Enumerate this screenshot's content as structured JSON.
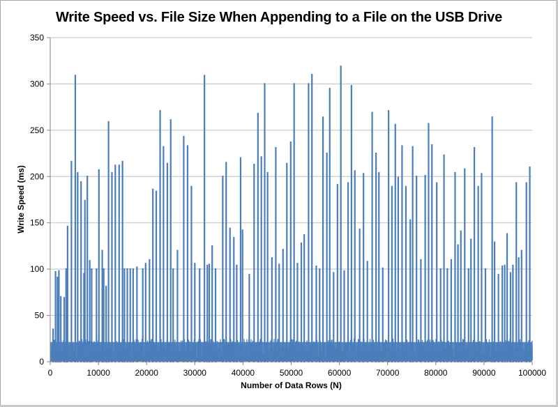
{
  "chart_data": {
    "type": "line",
    "title": "Write Speed vs. File Size When Appending to a File on the USB Drive",
    "xlabel": "Number of Data Rows (N)",
    "ylabel": "Write Speed (ms)",
    "xlim": [
      0,
      100000
    ],
    "ylim": [
      0,
      350
    ],
    "xticks": [
      0,
      10000,
      20000,
      30000,
      40000,
      50000,
      60000,
      70000,
      80000,
      90000,
      100000
    ],
    "yticks": [
      0,
      50,
      100,
      150,
      200,
      250,
      300,
      350
    ],
    "grid": "horizontal",
    "legend": "none",
    "series_color": "#4a7ebb",
    "series": [
      {
        "name": "Write Speed",
        "baseline_range_ms": [
          0,
          25
        ],
        "spikes": [
          {
            "x": 600,
            "y": 35
          },
          {
            "x": 1100,
            "y": 97
          },
          {
            "x": 1500,
            "y": 91
          },
          {
            "x": 1800,
            "y": 98
          },
          {
            "x": 2200,
            "y": 70
          },
          {
            "x": 2900,
            "y": 69
          },
          {
            "x": 3300,
            "y": 100
          },
          {
            "x": 3600,
            "y": 146
          },
          {
            "x": 4400,
            "y": 216
          },
          {
            "x": 5200,
            "y": 309
          },
          {
            "x": 5700,
            "y": 204
          },
          {
            "x": 6400,
            "y": 194
          },
          {
            "x": 7000,
            "y": 95
          },
          {
            "x": 7200,
            "y": 174
          },
          {
            "x": 7700,
            "y": 200
          },
          {
            "x": 8200,
            "y": 109
          },
          {
            "x": 8600,
            "y": 100
          },
          {
            "x": 9600,
            "y": 100
          },
          {
            "x": 10100,
            "y": 207
          },
          {
            "x": 10800,
            "y": 120
          },
          {
            "x": 11100,
            "y": 100
          },
          {
            "x": 11600,
            "y": 81
          },
          {
            "x": 12100,
            "y": 259
          },
          {
            "x": 12800,
            "y": 204
          },
          {
            "x": 13500,
            "y": 212
          },
          {
            "x": 14300,
            "y": 212
          },
          {
            "x": 15000,
            "y": 216
          },
          {
            "x": 15400,
            "y": 100
          },
          {
            "x": 16000,
            "y": 100
          },
          {
            "x": 16600,
            "y": 100
          },
          {
            "x": 17200,
            "y": 100
          },
          {
            "x": 18000,
            "y": 102
          },
          {
            "x": 19200,
            "y": 100
          },
          {
            "x": 19800,
            "y": 106
          },
          {
            "x": 20600,
            "y": 110
          },
          {
            "x": 21300,
            "y": 186
          },
          {
            "x": 22000,
            "y": 184
          },
          {
            "x": 22800,
            "y": 271
          },
          {
            "x": 23500,
            "y": 232
          },
          {
            "x": 24300,
            "y": 214
          },
          {
            "x": 25000,
            "y": 261
          },
          {
            "x": 25500,
            "y": 100
          },
          {
            "x": 26400,
            "y": 120
          },
          {
            "x": 27700,
            "y": 243
          },
          {
            "x": 28500,
            "y": 233
          },
          {
            "x": 29300,
            "y": 189
          },
          {
            "x": 30000,
            "y": 106
          },
          {
            "x": 31000,
            "y": 100
          },
          {
            "x": 32000,
            "y": 309
          },
          {
            "x": 32600,
            "y": 104
          },
          {
            "x": 33000,
            "y": 105
          },
          {
            "x": 33600,
            "y": 125
          },
          {
            "x": 34300,
            "y": 100
          },
          {
            "x": 35800,
            "y": 200
          },
          {
            "x": 36500,
            "y": 215
          },
          {
            "x": 37300,
            "y": 144
          },
          {
            "x": 38100,
            "y": 134
          },
          {
            "x": 38700,
            "y": 104
          },
          {
            "x": 39500,
            "y": 220
          },
          {
            "x": 39900,
            "y": 142
          },
          {
            "x": 41300,
            "y": 94
          },
          {
            "x": 42300,
            "y": 213
          },
          {
            "x": 43100,
            "y": 268
          },
          {
            "x": 43800,
            "y": 221
          },
          {
            "x": 44500,
            "y": 300
          },
          {
            "x": 45100,
            "y": 204
          },
          {
            "x": 46000,
            "y": 112
          },
          {
            "x": 46800,
            "y": 231
          },
          {
            "x": 47500,
            "y": 105
          },
          {
            "x": 48300,
            "y": 121
          },
          {
            "x": 49100,
            "y": 214
          },
          {
            "x": 49900,
            "y": 237
          },
          {
            "x": 50600,
            "y": 300
          },
          {
            "x": 51300,
            "y": 106
          },
          {
            "x": 52100,
            "y": 128
          },
          {
            "x": 52700,
            "y": 137
          },
          {
            "x": 53600,
            "y": 300
          },
          {
            "x": 54300,
            "y": 310
          },
          {
            "x": 55200,
            "y": 103
          },
          {
            "x": 55900,
            "y": 100
          },
          {
            "x": 56600,
            "y": 264
          },
          {
            "x": 57400,
            "y": 225
          },
          {
            "x": 58000,
            "y": 295
          },
          {
            "x": 58800,
            "y": 96
          },
          {
            "x": 59600,
            "y": 191
          },
          {
            "x": 60300,
            "y": 319
          },
          {
            "x": 61000,
            "y": 98
          },
          {
            "x": 61800,
            "y": 193
          },
          {
            "x": 62500,
            "y": 298
          },
          {
            "x": 63200,
            "y": 206
          },
          {
            "x": 64200,
            "y": 143
          },
          {
            "x": 65000,
            "y": 203
          },
          {
            "x": 65800,
            "y": 108
          },
          {
            "x": 66800,
            "y": 269
          },
          {
            "x": 67600,
            "y": 225
          },
          {
            "x": 68200,
            "y": 204
          },
          {
            "x": 69000,
            "y": 101
          },
          {
            "x": 70200,
            "y": 271
          },
          {
            "x": 70900,
            "y": 189
          },
          {
            "x": 71600,
            "y": 256
          },
          {
            "x": 72200,
            "y": 199
          },
          {
            "x": 73000,
            "y": 233
          },
          {
            "x": 73800,
            "y": 189
          },
          {
            "x": 74700,
            "y": 153
          },
          {
            "x": 75200,
            "y": 232
          },
          {
            "x": 76000,
            "y": 200
          },
          {
            "x": 76900,
            "y": 110
          },
          {
            "x": 77800,
            "y": 201
          },
          {
            "x": 78500,
            "y": 257
          },
          {
            "x": 79200,
            "y": 234
          },
          {
            "x": 80200,
            "y": 193
          },
          {
            "x": 81000,
            "y": 100
          },
          {
            "x": 81700,
            "y": 223
          },
          {
            "x": 82400,
            "y": 100
          },
          {
            "x": 83200,
            "y": 110
          },
          {
            "x": 84000,
            "y": 204
          },
          {
            "x": 84600,
            "y": 126
          },
          {
            "x": 85200,
            "y": 141
          },
          {
            "x": 86000,
            "y": 208
          },
          {
            "x": 86800,
            "y": 100
          },
          {
            "x": 87300,
            "y": 132
          },
          {
            "x": 88000,
            "y": 231
          },
          {
            "x": 88800,
            "y": 189
          },
          {
            "x": 89500,
            "y": 203
          },
          {
            "x": 90300,
            "y": 100
          },
          {
            "x": 91700,
            "y": 264
          },
          {
            "x": 92200,
            "y": 129
          },
          {
            "x": 93000,
            "y": 94
          },
          {
            "x": 93800,
            "y": 103
          },
          {
            "x": 94300,
            "y": 104
          },
          {
            "x": 94800,
            "y": 138
          },
          {
            "x": 95500,
            "y": 96
          },
          {
            "x": 96000,
            "y": 104
          },
          {
            "x": 96700,
            "y": 193
          },
          {
            "x": 97200,
            "y": 112
          },
          {
            "x": 97800,
            "y": 120
          },
          {
            "x": 98800,
            "y": 193
          },
          {
            "x": 99500,
            "y": 210
          }
        ]
      }
    ]
  }
}
